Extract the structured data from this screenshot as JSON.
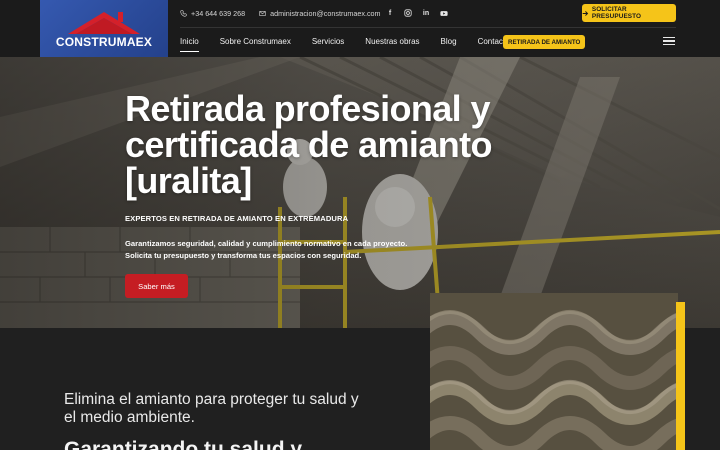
{
  "header": {
    "logo_text": "CONSTRUMAEX",
    "phone": "+34 644 639 268",
    "email": "administracion@construmaex.com",
    "social_icons": [
      "facebook-icon",
      "instagram-icon",
      "linkedin-icon",
      "youtube-icon"
    ],
    "cta_label": "SOLICITAR PRESUPUESTO",
    "nav": [
      "Inicio",
      "Sobre Construmaex",
      "Servicios",
      "Nuestras obras",
      "Blog",
      "Contacto"
    ],
    "nav_badge": "RETIRADA DE AMIANTO"
  },
  "hero": {
    "title": "Retirada profesional y certificada de amianto [uralita]",
    "subtitle": "EXPERTOS EN RETIRADA DE AMIANTO EN EXTREMADURA",
    "description_line1": "Garantizamos seguridad, calidad y cumplimiento normativo en cada proyecto.",
    "description_line2": "Solicita tu presupuesto y transforma tus espacios con seguridad.",
    "button_label": "Saber más"
  },
  "lower": {
    "heading": "Elimina el amianto para proteger tu salud y el medio ambiente.",
    "subheading": "Garantizando tu salud y"
  },
  "colors": {
    "accent_yellow": "#f5c419",
    "accent_red": "#c51d23",
    "logo_blue": "#2f50a3",
    "dark_bg": "#1e1e1e"
  }
}
